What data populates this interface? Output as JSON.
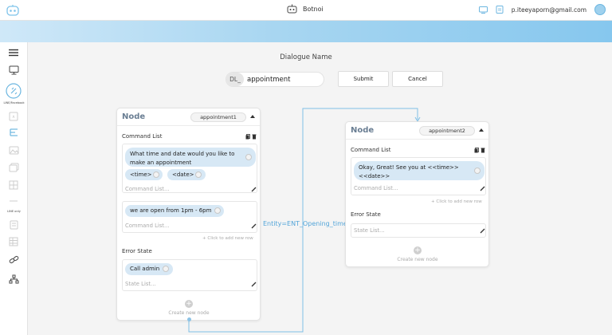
{
  "header": {
    "brand_name": "Botnoi",
    "user_email": "p.iteeyaporn@gmail.com"
  },
  "sidebar": {
    "items": [
      {
        "icon": "menu-icon"
      },
      {
        "icon": "monitor-icon"
      },
      {
        "icon": "integration-icon",
        "label": "LINE/Facebook"
      },
      {
        "icon": "text-icon"
      },
      {
        "icon": "flow-icon"
      },
      {
        "icon": "image-icon"
      },
      {
        "icon": "gallery-icon"
      },
      {
        "icon": "grid-icon"
      },
      {
        "icon": "line-only-icon",
        "label": "LINE only"
      },
      {
        "icon": "document-icon"
      },
      {
        "icon": "table-icon"
      },
      {
        "icon": "link-icon"
      },
      {
        "icon": "sitemap-icon"
      }
    ]
  },
  "dialogue": {
    "title": "Dialogue Name",
    "prefix": "DL_",
    "name_value": "appointment",
    "submit_label": "Submit",
    "cancel_label": "Cancel"
  },
  "node1": {
    "title": "Node",
    "tag": "appointment1",
    "command_label": "Command List",
    "commands": [
      {
        "text_line1": "What time and date would you like to",
        "text_line2": "make an appointment",
        "chips": [
          "<time>",
          "<date>"
        ],
        "placeholder": "Command List..."
      },
      {
        "text": "we are open from 1pm - 6pm",
        "placeholder": "Command List..."
      }
    ],
    "add_row": "+ Click to add new row",
    "error_label": "Error State",
    "error_chip": "Call admin",
    "error_placeholder": "State List...",
    "create_label": "Create new node"
  },
  "node2": {
    "title": "Node",
    "tag": "appointment2",
    "command_label": "Command List",
    "command_line1": "Okay, Great! See you at <<time>>",
    "command_line2": "<<date>>",
    "command_placeholder": "Command List...",
    "add_row": "+ Click to add new row",
    "error_label": "Error State",
    "error_placeholder": "State List...",
    "create_label": "Create new node"
  },
  "connector": {
    "label": "Entity=ENT_Opening_time"
  },
  "colors": {
    "accent": "#86c7ee",
    "chip": "#d7e8f5",
    "connector": "#7fbfe6",
    "node_title": "#6a7e93"
  }
}
